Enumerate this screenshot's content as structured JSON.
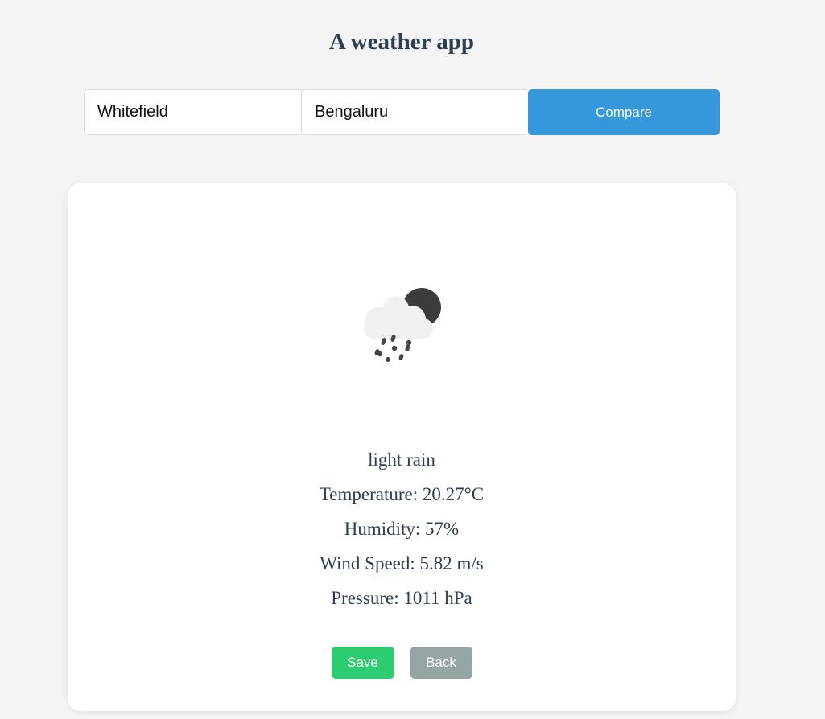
{
  "header": {
    "title": "A weather app"
  },
  "search": {
    "city_value": "Whitefield",
    "region_value": "Bengaluru",
    "compare_label": "Compare"
  },
  "weather": {
    "icon": "night-cloud-rain-icon",
    "description": "light rain",
    "temperature": "Temperature: 20.27°C",
    "humidity": "Humidity: 57%",
    "wind_speed": "Wind Speed: 5.82 m/s",
    "pressure": "Pressure: 1011 hPa"
  },
  "actions": {
    "save_label": "Save",
    "back_label": "Back"
  },
  "colors": {
    "accent": "#3498db",
    "save": "#2ecc71",
    "back": "#95a5a6",
    "text": "#2c3e50",
    "background": "#f4f4f4"
  }
}
